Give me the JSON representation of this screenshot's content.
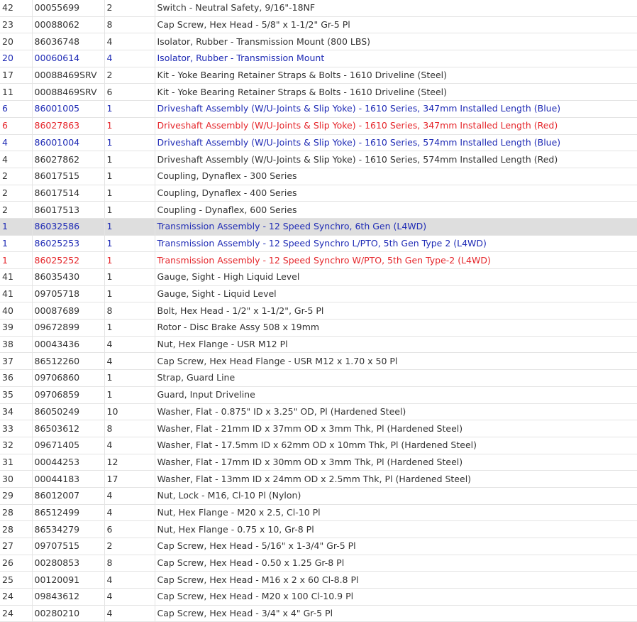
{
  "colors": {
    "default_text": "#333333",
    "blue_text": "#1f2bb5",
    "red_text": "#e5262b",
    "highlight_row": "#dedede",
    "grid_line": "#e4e4e4"
  },
  "rows": [
    {
      "item": "42",
      "part": "00055699",
      "qty": "2",
      "desc": "Switch - Neutral Safety, 9/16\"-18NF",
      "style": "normal"
    },
    {
      "item": "23",
      "part": "00088062",
      "qty": "8",
      "desc": "Cap Screw, Hex Head - 5/8\" x 1-1/2\" Gr-5 Pl",
      "style": "normal"
    },
    {
      "item": "20",
      "part": "86036748",
      "qty": "4",
      "desc": "Isolator, Rubber - Transmission Mount (800 LBS)",
      "style": "normal"
    },
    {
      "item": "20",
      "part": "00060614",
      "qty": "4",
      "desc": "Isolator, Rubber - Transmission Mount",
      "style": "blue"
    },
    {
      "item": "17",
      "part": "00088469SRV",
      "qty": "2",
      "desc": "Kit - Yoke Bearing Retainer Straps & Bolts - 1610 Driveline (Steel)",
      "style": "normal"
    },
    {
      "item": "11",
      "part": "00088469SRV",
      "qty": "6",
      "desc": "Kit - Yoke Bearing Retainer Straps & Bolts - 1610 Driveline (Steel)",
      "style": "normal"
    },
    {
      "item": "6",
      "part": "86001005",
      "qty": "1",
      "desc": "Driveshaft Assembly (W/U-Joints & Slip Yoke) - 1610 Series, 347mm Installed Length (Blue)",
      "style": "blue"
    },
    {
      "item": "6",
      "part": "86027863",
      "qty": "1",
      "desc": "Driveshaft Assembly (W/U-Joints & Slip Yoke) - 1610 Series, 347mm Installed Length (Red)",
      "style": "red"
    },
    {
      "item": "4",
      "part": "86001004",
      "qty": "1",
      "desc": "Driveshaft Assembly (W/U-Joints & Slip Yoke) - 1610 Series, 574mm Installed Length (Blue)",
      "style": "blue"
    },
    {
      "item": "4",
      "part": "86027862",
      "qty": "1",
      "desc": "Driveshaft Assembly (W/U-Joints & Slip Yoke) - 1610 Series, 574mm Installed Length (Red)",
      "style": "normal"
    },
    {
      "item": "2",
      "part": "86017515",
      "qty": "1",
      "desc": "Coupling, Dynaflex - 300 Series",
      "style": "normal"
    },
    {
      "item": "2",
      "part": "86017514",
      "qty": "1",
      "desc": "Coupling, Dynaflex - 400 Series",
      "style": "normal"
    },
    {
      "item": "2",
      "part": "86017513",
      "qty": "1",
      "desc": "Coupling - Dynaflex, 600 Series",
      "style": "normal"
    },
    {
      "item": "1",
      "part": "86032586",
      "qty": "1",
      "desc": "Transmission Assembly - 12 Speed Synchro, 6th Gen (L4WD)",
      "style": "blue",
      "highlight": true
    },
    {
      "item": "1",
      "part": "86025253",
      "qty": "1",
      "desc": "Transmission Assembly - 12 Speed Synchro L/PTO, 5th Gen Type 2 (L4WD)",
      "style": "blue"
    },
    {
      "item": "1",
      "part": "86025252",
      "qty": "1",
      "desc": "Transmission Assembly - 12 Speed Synchro W/PTO, 5th Gen Type-2 (L4WD)",
      "style": "red"
    },
    {
      "item": "41",
      "part": "86035430",
      "qty": "1",
      "desc": "Gauge, Sight - High Liquid Level",
      "style": "normal"
    },
    {
      "item": "41",
      "part": "09705718",
      "qty": "1",
      "desc": "Gauge, Sight - Liquid Level",
      "style": "normal"
    },
    {
      "item": "40",
      "part": "00087689",
      "qty": "8",
      "desc": "Bolt, Hex Head - 1/2\" x 1-1/2\", Gr-5 Pl",
      "style": "normal"
    },
    {
      "item": "39",
      "part": "09672899",
      "qty": "1",
      "desc": "Rotor - Disc Brake Assy 508 x 19mm",
      "style": "normal"
    },
    {
      "item": "38",
      "part": "00043436",
      "qty": "4",
      "desc": "Nut, Hex Flange - USR M12 Pl",
      "style": "normal"
    },
    {
      "item": "37",
      "part": "86512260",
      "qty": "4",
      "desc": "Cap Screw, Hex Head Flange - USR M12 x 1.70 x 50 Pl",
      "style": "normal"
    },
    {
      "item": "36",
      "part": "09706860",
      "qty": "1",
      "desc": "Strap, Guard Line",
      "style": "normal"
    },
    {
      "item": "35",
      "part": "09706859",
      "qty": "1",
      "desc": "Guard, Input Driveline",
      "style": "normal"
    },
    {
      "item": "34",
      "part": "86050249",
      "qty": "10",
      "desc": "Washer, Flat - 0.875\" ID x 3.25\" OD, Pl (Hardened Steel)",
      "style": "normal"
    },
    {
      "item": "33",
      "part": "86503612",
      "qty": "8",
      "desc": "Washer, Flat - 21mm ID x 37mm OD x 3mm Thk, Pl (Hardened Steel)",
      "style": "normal"
    },
    {
      "item": "32",
      "part": "09671405",
      "qty": "4",
      "desc": "Washer, Flat - 17.5mm ID x 62mm OD x 10mm Thk, Pl (Hardened Steel)",
      "style": "normal"
    },
    {
      "item": "31",
      "part": "00044253",
      "qty": "12",
      "desc": "Washer, Flat - 17mm ID x 30mm OD x 3mm Thk, Pl (Hardened Steel)",
      "style": "normal"
    },
    {
      "item": "30",
      "part": "00044183",
      "qty": "17",
      "desc": "Washer, Flat - 13mm ID x 24mm OD x 2.5mm Thk, Pl (Hardened Steel)",
      "style": "normal"
    },
    {
      "item": "29",
      "part": "86012007",
      "qty": "4",
      "desc": "Nut, Lock - M16, Cl-10 Pl (Nylon)",
      "style": "normal"
    },
    {
      "item": "28",
      "part": "86512499",
      "qty": "4",
      "desc": "Nut, Hex Flange - M20 x 2.5, Cl-10 Pl",
      "style": "normal"
    },
    {
      "item": "28",
      "part": "86534279",
      "qty": "6",
      "desc": "Nut, Hex Flange - 0.75 x 10, Gr-8 Pl",
      "style": "normal"
    },
    {
      "item": "27",
      "part": "09707515",
      "qty": "2",
      "desc": "Cap Screw, Hex Head - 5/16\" x 1-3/4\" Gr-5 Pl",
      "style": "normal"
    },
    {
      "item": "26",
      "part": "00280853",
      "qty": "8",
      "desc": "Cap Screw, Hex Head - 0.50 x 1.25 Gr-8 Pl",
      "style": "normal"
    },
    {
      "item": "25",
      "part": "00120091",
      "qty": "4",
      "desc": "Cap Screw, Hex Head - M16 x 2 x 60 Cl-8.8 Pl",
      "style": "normal"
    },
    {
      "item": "24",
      "part": "09843612",
      "qty": "4",
      "desc": "Cap Screw, Hex Head - M20 x 100 Cl-10.9 Pl",
      "style": "normal"
    },
    {
      "item": "24",
      "part": "00280210",
      "qty": "4",
      "desc": "Cap Screw, Hex Head - 3/4\" x 4\" Gr-5 Pl",
      "style": "normal"
    }
  ]
}
